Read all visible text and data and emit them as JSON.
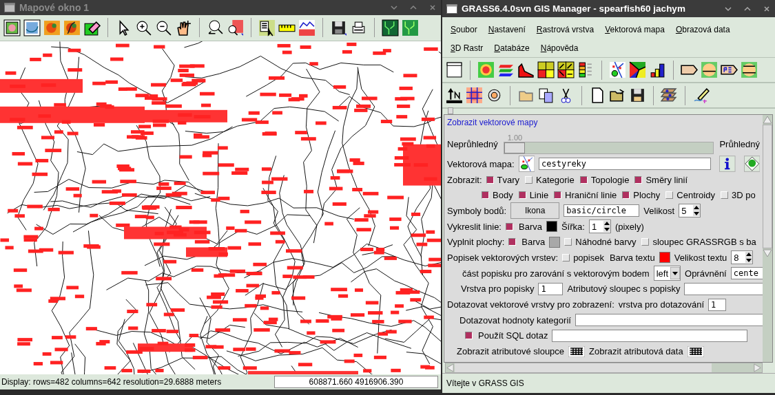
{
  "map_window": {
    "title": "Mapové okno 1",
    "status_text": "Display: rows=482 columns=642  resolution=29.6888 meters",
    "coordinates": "608871.660 4916906.390"
  },
  "manager_window": {
    "title": "GRASS6.4.0svn GIS Manager - spearfish60 jachym",
    "menus": [
      {
        "label": "Soubor"
      },
      {
        "label": "Nastavení"
      },
      {
        "label": "Rastrová vrstva"
      },
      {
        "label": "Vektorová mapa"
      },
      {
        "label": "Obrazová data"
      },
      {
        "label": "3D Rastr"
      },
      {
        "label": "Databáze"
      },
      {
        "label": "Nápověda"
      }
    ],
    "form": {
      "title": "Zobrazit vektorové mapy",
      "opacity": {
        "reading": "1.00",
        "left_label": "Neprůhledný",
        "right_label": "Průhledný",
        "level": 0
      },
      "rows": [
        {
          "items": [
            {
              "kind": "label",
              "text": "Vektorová mapa:"
            },
            {
              "kind": "map_button"
            },
            {
              "kind": "field",
              "value": "cestyreky"
            },
            {
              "kind": "info_button"
            },
            {
              "kind": "help_button"
            }
          ]
        },
        {
          "items": [
            {
              "kind": "label",
              "text": "Zobrazit:"
            },
            {
              "kind": "checkbox",
              "label": "Tvary",
              "checked": true
            },
            {
              "kind": "checkbox",
              "label": "Kategorie",
              "checked": false
            },
            {
              "kind": "checkbox",
              "label": "Topologie",
              "checked": true
            },
            {
              "kind": "checkbox",
              "label": "Směry linií",
              "checked": true
            }
          ]
        },
        {
          "items": [
            {
              "kind": "checkbox",
              "label": "Body",
              "checked": true
            },
            {
              "kind": "checkbox",
              "label": "Linie",
              "checked": true
            },
            {
              "kind": "checkbox",
              "label": "Hraniční linie",
              "checked": true
            },
            {
              "kind": "checkbox",
              "label": "Plochy",
              "checked": true
            },
            {
              "kind": "checkbox",
              "label": "Centroidy",
              "checked": false
            },
            {
              "kind": "checkbox",
              "label": "3D po",
              "checked": false
            }
          ]
        },
        {
          "items": [
            {
              "kind": "label",
              "text": "Symboly bodů:"
            },
            {
              "kind": "button",
              "label": "Ikona"
            },
            {
              "kind": "field",
              "value": "basic/circle"
            },
            {
              "kind": "label",
              "text": "Velikost"
            },
            {
              "kind": "spinner",
              "value": "5"
            }
          ]
        },
        {
          "items": [
            {
              "kind": "label",
              "text": "Vykreslit linie:"
            },
            {
              "kind": "checkbox",
              "checked": true
            },
            {
              "kind": "label",
              "text": "Barva"
            },
            {
              "kind": "swatch",
              "color": "#000000"
            },
            {
              "kind": "label",
              "text": "Šířka:"
            },
            {
              "kind": "spinner",
              "value": "1"
            },
            {
              "kind": "label",
              "text": "(pixely)"
            }
          ]
        },
        {
          "items": [
            {
              "kind": "label",
              "text": "Vyplnit plochy:"
            },
            {
              "kind": "checkbox",
              "checked": true
            },
            {
              "kind": "label",
              "text": "Barva"
            },
            {
              "kind": "swatch",
              "color": "#a8a8a8"
            },
            {
              "kind": "checkbox",
              "label": "Náhodné barvy",
              "checked": false
            },
            {
              "kind": "checkbox",
              "label": "sloupec GRASSRGB s ba",
              "checked": false
            }
          ]
        },
        {
          "items": [
            {
              "kind": "label",
              "text": "Popisek vektorových vrstev:"
            },
            {
              "kind": "checkbox",
              "label": "popisek",
              "checked": false
            },
            {
              "kind": "label",
              "text": "Barva textu"
            },
            {
              "kind": "swatch",
              "color": "#ff0000"
            },
            {
              "kind": "label",
              "text": "Velikost textu"
            },
            {
              "kind": "spinner",
              "value": "8"
            }
          ]
        },
        {
          "items": [
            {
              "kind": "label",
              "text": "část popisku pro zarování s vektorovým bodem"
            },
            {
              "kind": "select",
              "value": "left"
            },
            {
              "kind": "label",
              "text": "Oprávnění"
            },
            {
              "kind": "field",
              "value": "cente"
            }
          ]
        },
        {
          "items": [
            {
              "kind": "label",
              "text": "Vrstva pro popisky"
            },
            {
              "kind": "field",
              "value": "1"
            },
            {
              "kind": "label",
              "text": "Atributový sloupec s popisky"
            },
            {
              "kind": "field"
            }
          ]
        },
        {
          "items": [
            {
              "kind": "label",
              "text": "Dotazovat vektorové vrstvy pro zobrazení:"
            },
            {
              "kind": "label",
              "text": "vrstva pro dotazování"
            },
            {
              "kind": "field",
              "value": "1"
            }
          ]
        },
        {
          "items": [
            {
              "kind": "label",
              "text": "Dotazovat hodnoty kategorií"
            },
            {
              "kind": "field"
            }
          ]
        },
        {
          "items": [
            {
              "kind": "checkbox",
              "checked": true
            },
            {
              "kind": "label",
              "text": "Použít SQL dotaz"
            },
            {
              "kind": "field"
            }
          ]
        },
        {
          "items": [
            {
              "kind": "label",
              "text": "Zobrazit atributové sloupce"
            },
            {
              "kind": "table_button"
            },
            {
              "kind": "label",
              "text": "Zobrazit atributová data"
            },
            {
              "kind": "table_button"
            }
          ]
        }
      ]
    },
    "status_text": "Vítejte v GRASS GIS"
  }
}
